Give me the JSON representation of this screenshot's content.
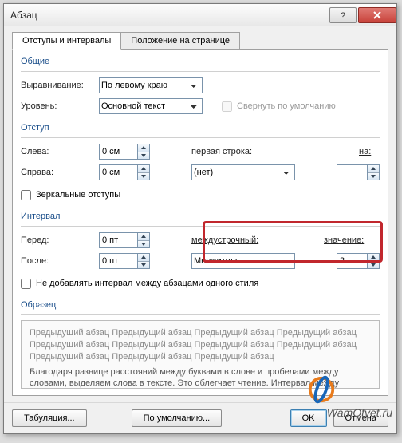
{
  "title": "Абзац",
  "tabs": {
    "t1": "Отступы и интервалы",
    "t2": "Положение на странице"
  },
  "grp_general": "Общие",
  "align_label": "Выравнивание:",
  "align_value": "По левому краю",
  "level_label": "Уровень:",
  "level_value": "Основной текст",
  "collapse_label": "Свернуть по умолчанию",
  "grp_indent": "Отступ",
  "left_label": "Слева:",
  "left_value": "0 см",
  "right_label": "Справа:",
  "right_value": "0 см",
  "firstline_label": "первая строка:",
  "firstline_value": "(нет)",
  "on_label": "на:",
  "on_value": "",
  "mirror_label": "Зеркальные отступы",
  "grp_spacing": "Интервал",
  "before_label": "Перед:",
  "before_value": "0 пт",
  "after_label": "После:",
  "after_value": "0 пт",
  "linespacing_label": "междустрочный:",
  "linespacing_value": "Множитель",
  "value_label": "значение:",
  "value_value": "2",
  "dontadd_label": "Не добавлять интервал между абзацами одного стиля",
  "grp_preview": "Образец",
  "preview_p1": "Предыдущий абзац Предыдущий абзац Предыдущий абзац Предыдущий абзац Предыдущий абзац Предыдущий абзац Предыдущий абзац Предыдущий абзац Предыдущий абзац Предыдущий абзац Предыдущий абзац",
  "preview_p2": "Благодаря разнице расстояний между буквами в слове и пробелами между словами, выделяем слова в тексте. Это облегчает чтение. Интервал между строками также влияет на скорость восприятия текста.",
  "btn_tabs": "Табуляция...",
  "btn_default": "По умолчанию...",
  "btn_ok": "OK",
  "btn_cancel": "Отмена",
  "watermark": "WamOtvet.ru"
}
